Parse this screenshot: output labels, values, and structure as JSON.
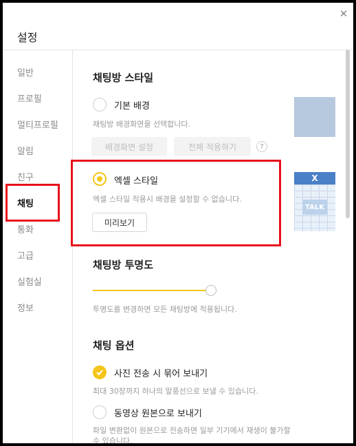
{
  "window": {
    "title": "설정",
    "close_symbol": "✕"
  },
  "sidebar": {
    "items": [
      {
        "label": "일반"
      },
      {
        "label": "프로필"
      },
      {
        "label": "멀티프로필"
      },
      {
        "label": "알림"
      },
      {
        "label": "친구"
      },
      {
        "label": "채팅",
        "active": true
      },
      {
        "label": "통화"
      },
      {
        "label": "고급"
      },
      {
        "label": "실험실"
      },
      {
        "label": "정보"
      }
    ]
  },
  "chat_style": {
    "heading": "채팅방 스타일",
    "basic": {
      "label": "기본 배경",
      "desc": "채팅방 배경화면을 선택합니다.",
      "btn_bg": "배경화면 설정",
      "btn_apply_all": "전체 적용하기",
      "help": "?"
    },
    "excel": {
      "label": "엑셀 스타일",
      "desc": "엑셀 스타일 적용시 배경을 설정할 수 없습니다.",
      "btn_preview": "미리보기",
      "thumb_header": "X",
      "thumb_talk": "TALK",
      "selected": true
    }
  },
  "opacity": {
    "heading": "채팅방 투명도",
    "desc": "투명도를 변경하면 모든 채팅방에 적용됩니다.",
    "level": 1.0
  },
  "options": {
    "heading": "채팅 옵션",
    "photo_bundle": {
      "label": "사진 전송 시 묶어 보내기",
      "desc": "최대 30장까지 하나의 말풍선으로 보낼 수 있습니다.",
      "checked": true
    },
    "original_video": {
      "label": "동영상 원본으로 보내기",
      "desc_line1": "파일 변환없이 원본으로 전송하면 일부 기기에서 재생이 불가할",
      "desc_line2": "수 있습니다.",
      "checked": false
    }
  },
  "colors": {
    "accent": "#f5c518",
    "highlight": "#e8101b",
    "thumb_blue": "#4a80c8"
  }
}
